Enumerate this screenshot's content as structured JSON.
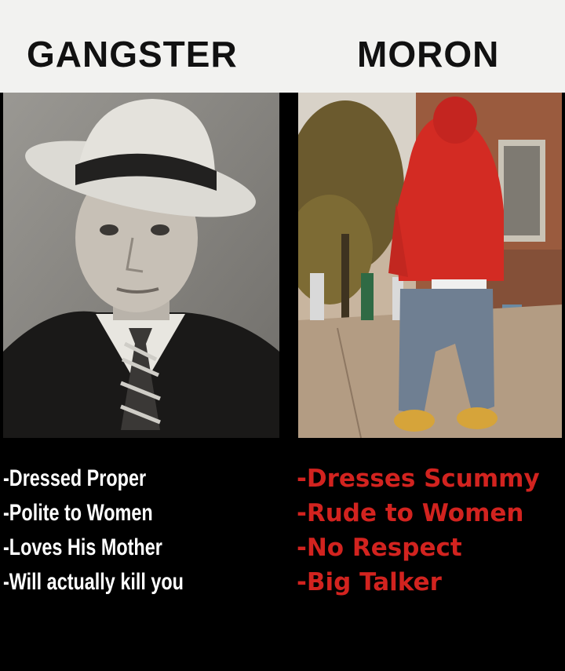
{
  "titles": {
    "left": "GANGSTER",
    "right": "MORON"
  },
  "captions": {
    "left": [
      "-Dressed Proper",
      "-Polite to Women",
      "-Loves His Mother",
      "-Will actually kill you"
    ],
    "right": [
      "-Dresses Scummy",
      "-Rude to Women",
      "-No Respect",
      "-Big Talker"
    ]
  },
  "colors": {
    "header_bg": "#f2f2f0",
    "caption_left": "#ffffff",
    "caption_right": "#d2231f",
    "background": "#000000"
  }
}
